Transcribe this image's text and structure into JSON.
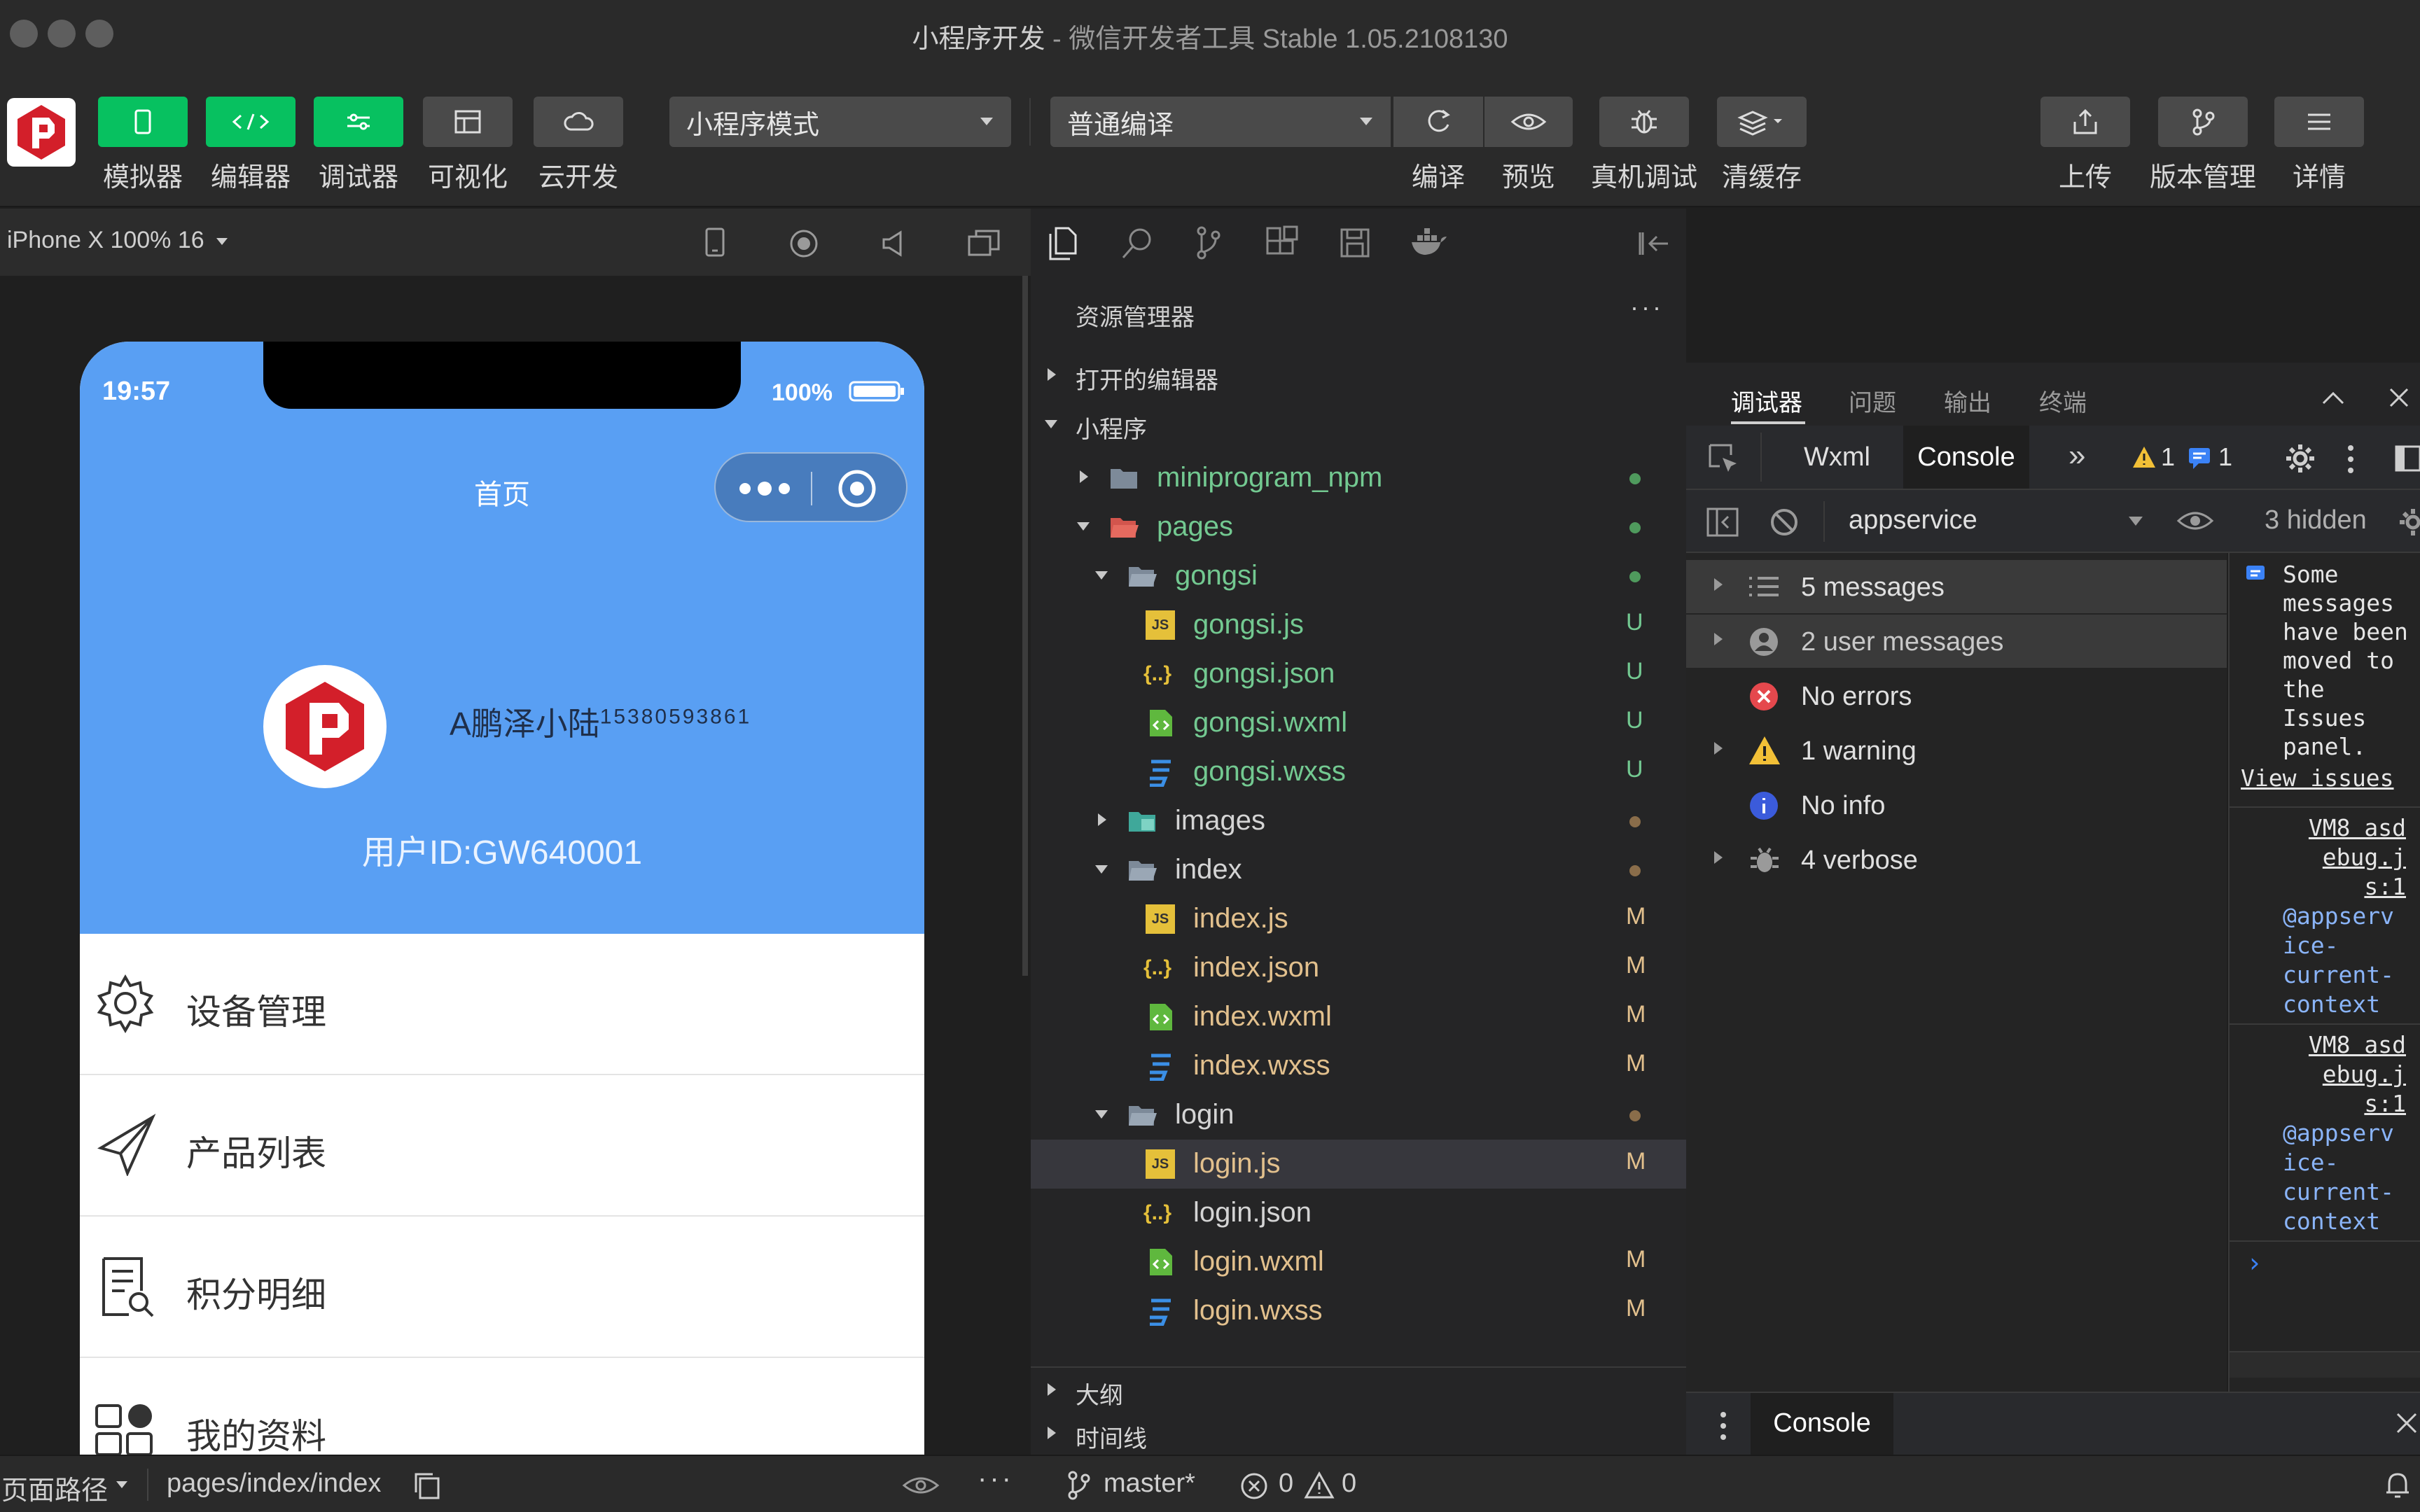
{
  "window": {
    "title_main": "小程序开发",
    "title_sub": "- 微信开发者工具 Stable 1.05.2108130"
  },
  "toolbar": {
    "simulator": "模拟器",
    "editor": "编辑器",
    "debugger": "调试器",
    "visual": "可视化",
    "cloud": "云开发",
    "mode_select": "小程序模式",
    "compile_select": "普通编译",
    "compile": "编译",
    "preview": "预览",
    "real_debug": "真机调试",
    "clear_cache": "清缓存",
    "upload": "上传",
    "version": "版本管理",
    "details": "详情"
  },
  "simulator": {
    "device": "iPhone X 100% 16",
    "phone": {
      "time": "19:57",
      "battery": "100%",
      "nav_title": "首页",
      "user_name": "A鹏泽小陆",
      "user_phone": "15380593861",
      "user_id": "用户ID:GW640001",
      "menu": [
        {
          "label": "设备管理",
          "icon": "gear-icon"
        },
        {
          "label": "产品列表",
          "icon": "paper-plane-icon"
        },
        {
          "label": "积分明细",
          "icon": "document-search-icon"
        },
        {
          "label": "我的资料",
          "icon": "grid-icon"
        }
      ]
    }
  },
  "explorer": {
    "title": "资源管理器",
    "open_editors": "打开的编辑器",
    "project": "小程序",
    "files": [
      {
        "name": "miniprogram_npm",
        "status": "",
        "dot": "#4f9a5d"
      },
      {
        "name": "pages",
        "status": "",
        "dot": "#4f9a5d"
      },
      {
        "name": "gongsi",
        "status": "",
        "dot": "#4f9a5d"
      },
      {
        "name": "gongsi.js",
        "status": "U"
      },
      {
        "name": "gongsi.json",
        "status": "U"
      },
      {
        "name": "gongsi.wxml",
        "status": "U"
      },
      {
        "name": "gongsi.wxss",
        "status": "U"
      },
      {
        "name": "images",
        "status": "",
        "dot": "#8a6d4a"
      },
      {
        "name": "index",
        "status": "",
        "dot": "#8a6d4a"
      },
      {
        "name": "index.js",
        "status": "M"
      },
      {
        "name": "index.json",
        "status": "M"
      },
      {
        "name": "index.wxml",
        "status": "M"
      },
      {
        "name": "index.wxss",
        "status": "M"
      },
      {
        "name": "login",
        "status": "",
        "dot": "#8a6d4a"
      },
      {
        "name": "login.js",
        "status": "M"
      },
      {
        "name": "login.json",
        "status": ""
      },
      {
        "name": "login.wxml",
        "status": "M"
      },
      {
        "name": "login.wxss",
        "status": "M"
      }
    ],
    "outline": "大纲",
    "timeline": "时间线"
  },
  "debugger": {
    "panel_tabs": [
      "调试器",
      "问题",
      "输出",
      "终端"
    ],
    "tabs": {
      "wxml": "Wxml",
      "console": "Console"
    },
    "warn_count": "1",
    "msg_count": "1",
    "context": "appservice",
    "hidden": "3 hidden",
    "sidebar": [
      {
        "label": "5 messages",
        "icon": "list-icon"
      },
      {
        "label": "2 user messages",
        "icon": "user-icon"
      },
      {
        "label": "No errors",
        "icon": "error-icon"
      },
      {
        "label": "1 warning",
        "icon": "warning-icon"
      },
      {
        "label": "No info",
        "icon": "info-icon"
      },
      {
        "label": "4 verbose",
        "icon": "bug-icon"
      }
    ],
    "issues_notice": [
      "Some",
      "messages",
      "have been",
      "moved to",
      "the",
      "Issues",
      "panel."
    ],
    "view_issues": "View issues",
    "log1_source": [
      "VM8 asd",
      "ebug.j",
      "s:1"
    ],
    "log1_context": [
      "@appserv",
      "ice-",
      "current-",
      "context"
    ],
    "log2_source": [
      "VM8 asd",
      "ebug.j",
      "s:1"
    ],
    "log2_context": [
      "@appserv",
      "ice-",
      "current-",
      "context"
    ],
    "drawer_tab": "Console"
  },
  "status": {
    "page_path_label": "页面路径",
    "page_path": "pages/index/index",
    "branch": "master*",
    "errors": "0",
    "warnings": "0"
  },
  "colors": {
    "accent_green": "#07c160",
    "phone_blue": "#599ff3",
    "console_link": "#8ab4f8"
  }
}
